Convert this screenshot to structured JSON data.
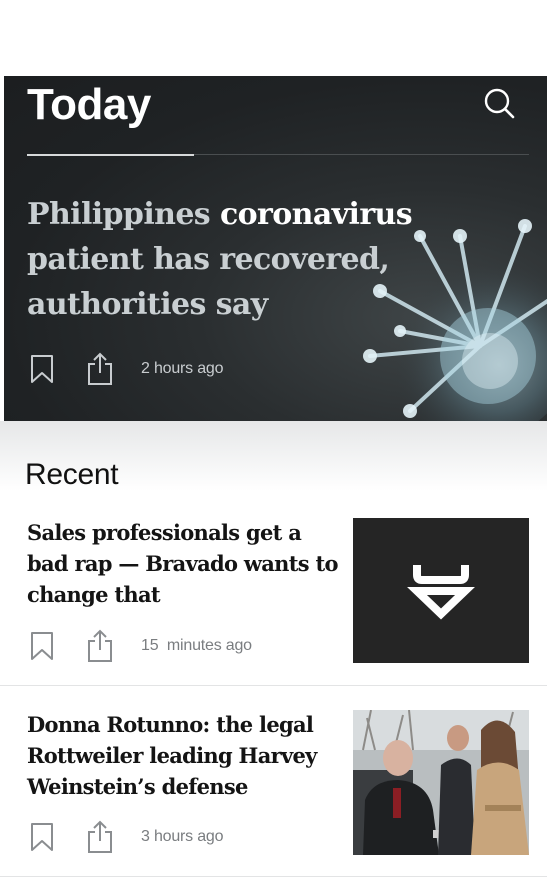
{
  "header": {
    "title": "Today"
  },
  "hero": {
    "headline_part1": "Philippines ",
    "headline_part2": "coronavirus",
    "headline_part3": " patient has recovered, authorities say",
    "time": "2 hours ago"
  },
  "recent": {
    "title": "Recent",
    "articles": [
      {
        "headline": "Sales professionals get a bad rap — Bravado wants to change that",
        "time": "15  minutes ago",
        "thumb": "bravado-logo"
      },
      {
        "headline": "Donna Rotunno: the legal Rottweiler leading Harvey Weinstein’s defense",
        "time": "3 hours ago",
        "thumb": "courtroom-photo"
      }
    ]
  },
  "icons": {
    "search": "search-icon",
    "bookmark": "bookmark-icon",
    "share": "share-icon"
  },
  "colors": {
    "hero_background": "#1f2224",
    "bravado_tile": "#252525",
    "text_dark": "#141414",
    "time_gray": "#7a7d80"
  }
}
